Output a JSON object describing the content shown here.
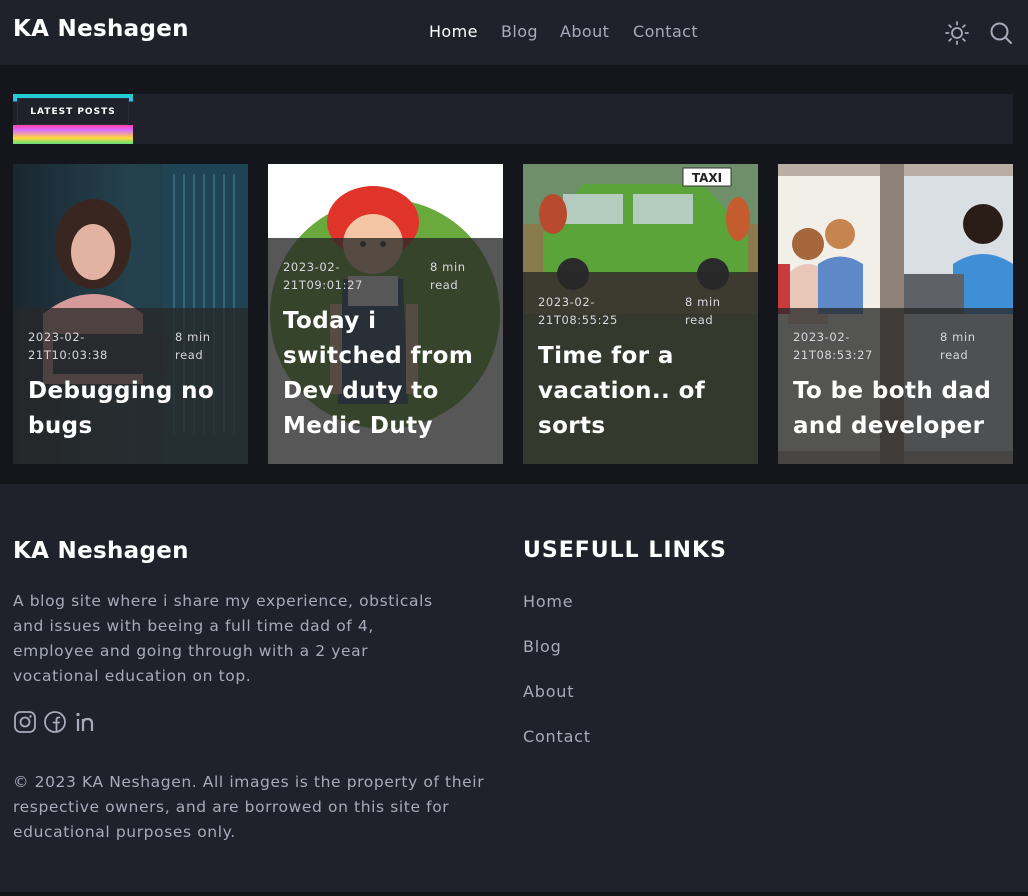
{
  "site": {
    "brand": "KA Neshagen"
  },
  "nav": {
    "items": [
      {
        "label": "Home",
        "active": true
      },
      {
        "label": "Blog",
        "active": false
      },
      {
        "label": "About",
        "active": false
      },
      {
        "label": "Contact",
        "active": false
      }
    ],
    "icons": {
      "theme": "sun-icon",
      "search": "search-icon"
    }
  },
  "latest": {
    "badge": "LATEST POSTS"
  },
  "posts": [
    {
      "date": "2023-02-21T10:03:38",
      "read": "8 min read",
      "title": "Debugging no bugs"
    },
    {
      "date": "2023-02-21T09:01:27",
      "read": "8 min read",
      "title": "Today i switched from Dev duty to Medic Duty"
    },
    {
      "date": "2023-02-21T08:55:25",
      "read": "8 min read",
      "title": "Time for a vacation.. of sorts"
    },
    {
      "date": "2023-02-21T08:53:27",
      "read": "8 min read",
      "title": "To be both dad and developer"
    }
  ],
  "footer": {
    "brand": "KA Neshagen",
    "description": "A blog site where i share my experience, obsticals and issues with beeing a full time dad of 4, employee and going through with a 2 year vocational education on top.",
    "social": [
      "instagram-icon",
      "facebook-icon",
      "linkedin-icon"
    ],
    "links_title": "USEFULL LINKS",
    "links": [
      "Home",
      "Blog",
      "About",
      "Contact"
    ],
    "copyright": "© 2023 KA Neshagen. All images is the property of their respective owners, and are borrowed on this site for educational purposes only."
  },
  "colors": {
    "bg": "#14161b",
    "panel": "#1f222b",
    "muted": "#a7abba",
    "white": "#ffffff"
  }
}
